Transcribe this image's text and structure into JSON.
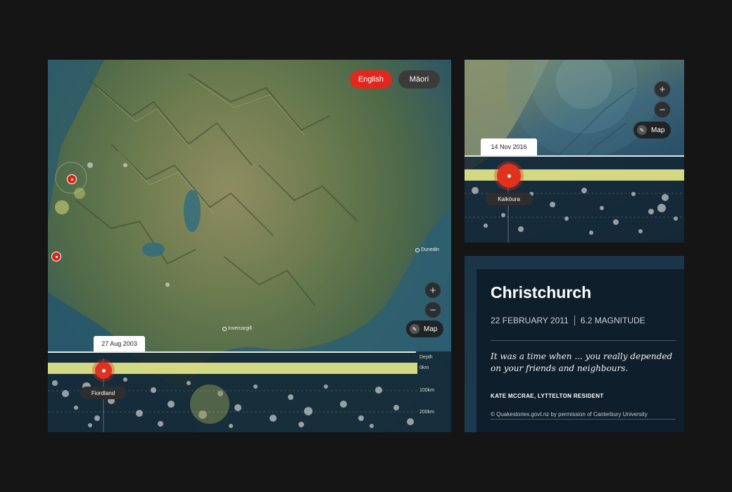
{
  "main_map": {
    "language_buttons": {
      "english": "English",
      "maori": "Māori"
    },
    "zoom_in": "+",
    "zoom_out": "−",
    "map_button": "Map",
    "places": {
      "dunedin": "Dunedin",
      "invercargill": "Invercargill"
    },
    "timeline": {
      "date": "27 Aug 2003",
      "location": "Fiordland",
      "depth_label": "Depth",
      "depth_ticks": [
        "0km",
        "100km",
        "200km"
      ]
    }
  },
  "kaikoura_map": {
    "zoom_in": "+",
    "zoom_out": "−",
    "map_button": "Map",
    "timeline": {
      "date": "14 Nov 2016",
      "location": "Kaikōura"
    }
  },
  "story": {
    "title": "Christchurch",
    "date": "22 FEBRUARY 2011",
    "magnitude": "6.2 MAGNITUDE",
    "quote": "It was a time when ... you really depended on your friends and neighbours.",
    "author": "KATE MCCRAE, LYTTELTON RESIDENT",
    "credit": "© Quakestories.govt.nz by permission of Canterbury University"
  },
  "colors": {
    "accent": "#e2271f",
    "quake_glow": "#f2f58a",
    "background": "#151515"
  }
}
